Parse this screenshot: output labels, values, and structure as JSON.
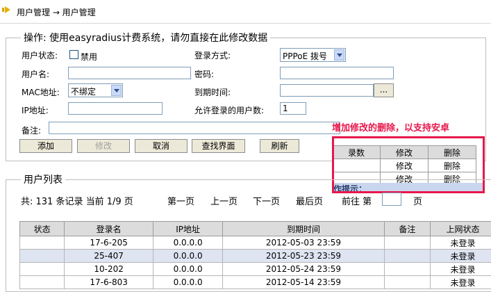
{
  "breadcrumb": "用户管理 → 用户管理",
  "ops": {
    "legend": "操作: 使用easyradius计费系统，请勿直接在此修改数据",
    "user_status_label": "用户状态:",
    "disable_label": "禁用",
    "login_mode_label": "登录方式:",
    "login_mode_value": "PPPoE 拨号",
    "username_label": "用户名:",
    "password_label": "密码:",
    "mac_label": "MAC地址:",
    "mac_value": "不绑定",
    "expire_label": "到期时间:",
    "expire_btn": "...",
    "ip_label": "IP地址:",
    "allowed_users_label": "允许登录的用户数:",
    "allowed_users_value": "1",
    "remark_label": "备注:",
    "buttons": {
      "add": "添加",
      "modify": "修改",
      "cancel": "取消",
      "search": "查找界面",
      "refresh": "刷新"
    }
  },
  "annotation": {
    "text": "增加修改的删除，以支持安卓",
    "header": [
      "录数",
      "修改",
      "删除"
    ],
    "row": [
      "",
      "修改",
      "删除"
    ],
    "row_partial": [
      "",
      "修改",
      "删除"
    ],
    "tip": "作提示："
  },
  "list": {
    "legend": "用户列表",
    "summary": "共:  131 条记录 当前 1/9 页",
    "nav": {
      "first": "第一页",
      "prev": "上一页",
      "next": "下一页",
      "last": "最后页",
      "goto": "前往 第",
      "page_suffix": "页"
    },
    "columns": [
      "状态",
      "登录名",
      "IP地址",
      "到期时间",
      "备注",
      "上网状态"
    ],
    "rows": [
      [
        "",
        "17-6-205",
        "0.0.0.0",
        "2012-05-03 23:59",
        "",
        "未登录"
      ],
      [
        "",
        "25-407",
        "0.0.0.0",
        "2012-05-23 23:59",
        "",
        "未登录"
      ],
      [
        "",
        "10-202",
        "0.0.0.0",
        "2012-05-24 23:59",
        "",
        "未登录"
      ],
      [
        "",
        "17-6-803",
        "0.0.0.0",
        "2012-05-14 23:59",
        "",
        "未登录"
      ]
    ]
  }
}
